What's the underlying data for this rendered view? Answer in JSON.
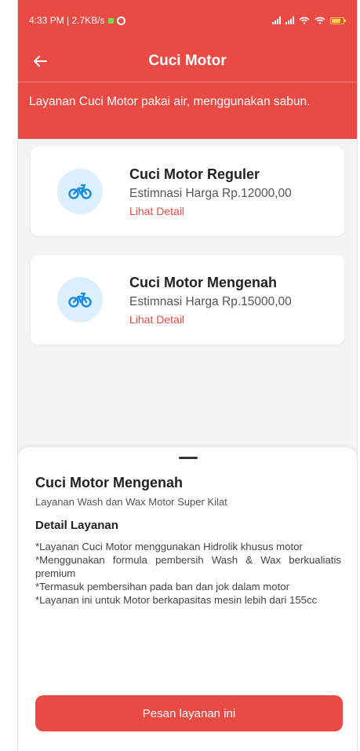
{
  "status_bar": {
    "time_info": "4:33 PM | 2.7KB/s",
    "signal_icon": "signal-icon",
    "wifi_icon": "wifi-icon",
    "battery_icon": "battery-icon"
  },
  "app_bar": {
    "back_icon": "arrow-left-icon",
    "title": "Cuci Motor"
  },
  "banner": {
    "text": "Layanan Cuci Motor pakai air, menggunakan sabun."
  },
  "services": [
    {
      "icon": "motorcycle-icon",
      "title": "Cuci Motor Reguler",
      "price": "Estimnasi Harga Rp.12000,00",
      "link": "Lihat Detail"
    },
    {
      "icon": "motorcycle-icon",
      "title": "Cuci Motor Mengenah",
      "price": "Estimnasi Harga Rp.15000,00",
      "link": "Lihat Detail"
    }
  ],
  "sheet": {
    "title": "Cuci Motor Mengenah",
    "subtitle": "Layanan Wash dan Wax Motor Super Kilat",
    "section_title": "Detail Layanan",
    "details": [
      "*Layanan Cuci Motor menggunakan Hidrolik khusus motor",
      "*Menggunakan formula pembersih Wash & Wax berkualiatis premium",
      "*Termasuk pembersihan pada ban dan jok dalam motor",
      "*Layanan ini untuk Motor berkapasitas mesin lebih dari 155cc"
    ],
    "button_label": "Pesan layanan ini"
  },
  "colors": {
    "primary": "#e94a43",
    "icon_bg": "#dceffd",
    "icon": "#1e8fe0"
  }
}
